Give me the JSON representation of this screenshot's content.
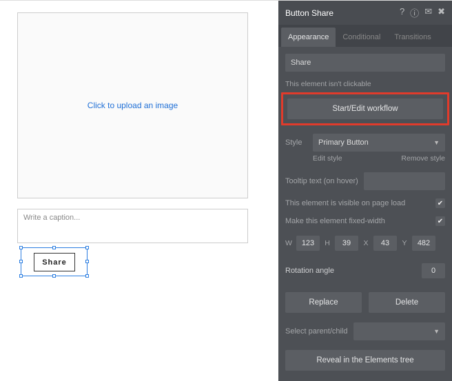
{
  "canvas": {
    "upload_text": "Click to upload an image",
    "caption_placeholder": "Write a caption...",
    "share_label": "Share"
  },
  "panel": {
    "title": "Button Share",
    "tabs": {
      "appearance": "Appearance",
      "conditional": "Conditional",
      "transitions": "Transitions"
    },
    "name_value": "Share",
    "not_clickable_note": "This element isn't clickable",
    "workflow_btn": "Start/Edit workflow",
    "style_label": "Style",
    "style_value": "Primary Button",
    "edit_style": "Edit style",
    "remove_style": "Remove style",
    "tooltip_label": "Tooltip text (on hover)",
    "visible_label": "This element is visible on page load",
    "fixed_label": "Make this element fixed-width",
    "dims": {
      "w_label": "W",
      "w": "123",
      "h_label": "H",
      "h": "39",
      "x_label": "X",
      "x": "43",
      "y_label": "Y",
      "y": "482"
    },
    "rotation_label": "Rotation angle",
    "rotation_value": "0",
    "replace": "Replace",
    "delete": "Delete",
    "select_pc": "Select parent/child",
    "reveal": "Reveal in the Elements tree"
  }
}
